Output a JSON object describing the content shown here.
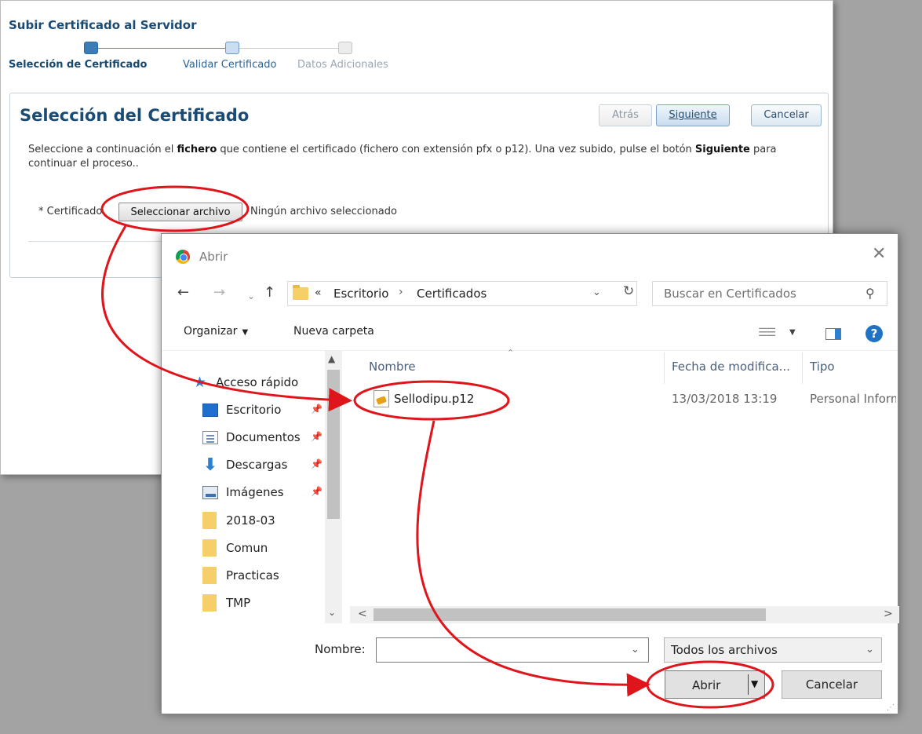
{
  "webpage": {
    "header": "Subir Certificado al Servidor",
    "train": [
      {
        "label": "Selección de Certificado",
        "state": "active"
      },
      {
        "label": "Validar Certificado",
        "state": "next"
      },
      {
        "label": "Datos Adicionales",
        "state": "disabled"
      }
    ],
    "step": {
      "title": "Selección del Certificado",
      "buttons": {
        "back": "Atrás",
        "next": "Siguiente",
        "cancel": "Cancelar"
      },
      "instructions": {
        "part1": "Seleccione a continuación el ",
        "bold1": "fichero",
        "part2": " que contiene el certificado (fichero con extensión pfx o p12). Una vez subido, pulse el botón ",
        "bold2": "Siguiente",
        "part3": " para continuar el proceso.."
      },
      "certificate": {
        "label": "* Certificado",
        "choose_button": "Seleccionar archivo",
        "status": "Ningún archivo seleccionado"
      }
    }
  },
  "dialog": {
    "title": "Abrir",
    "address": {
      "overflow": "«",
      "crumbs": [
        "Escritorio",
        "Certificados"
      ],
      "separator": "›"
    },
    "search_placeholder": "Buscar en Certificados",
    "toolbar": {
      "organize": "Organizar",
      "new_folder": "Nueva carpeta"
    },
    "nav_pane": {
      "quick_access": "Acceso rápido",
      "items": [
        {
          "label": "Escritorio",
          "icon": "desktop-icon",
          "pinned": true
        },
        {
          "label": "Documentos",
          "icon": "documents-icon",
          "pinned": true
        },
        {
          "label": "Descargas",
          "icon": "downloads-icon",
          "pinned": true
        },
        {
          "label": "Imágenes",
          "icon": "images-icon",
          "pinned": true
        },
        {
          "label": "2018-03",
          "icon": "folder-icon",
          "pinned": false
        },
        {
          "label": "Comun",
          "icon": "folder-icon",
          "pinned": false
        },
        {
          "label": "Practicas",
          "icon": "folder-icon",
          "pinned": false
        },
        {
          "label": "TMP",
          "icon": "folder-icon",
          "pinned": false
        }
      ]
    },
    "columns": [
      "Nombre",
      "Fecha de modifica...",
      "Tipo"
    ],
    "files": [
      {
        "name": "Sellodipu.p12",
        "date": "13/03/2018 13:19",
        "type": "Personal Inform"
      }
    ],
    "filename": {
      "label": "Nombre:",
      "value": ""
    },
    "filter": "Todos los archivos",
    "buttons": {
      "open": "Abrir",
      "cancel": "Cancelar"
    }
  },
  "colors": {
    "annotation": "#e0141b",
    "title_blue": "#1b4b73",
    "link_blue": "#2b6497",
    "help_blue": "#1f72c4"
  }
}
